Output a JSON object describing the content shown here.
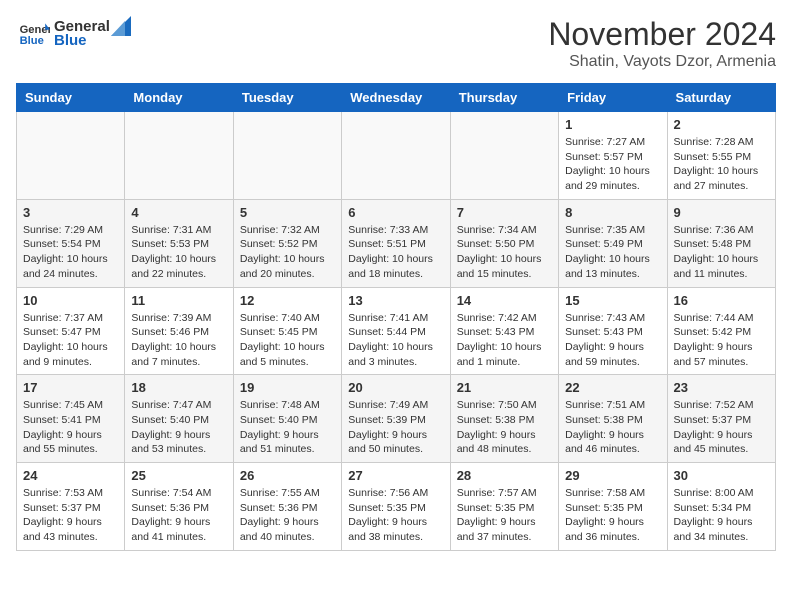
{
  "header": {
    "logo_general": "General",
    "logo_blue": "Blue",
    "month_title": "November 2024",
    "location": "Shatin, Vayots Dzor, Armenia"
  },
  "weekdays": [
    "Sunday",
    "Monday",
    "Tuesday",
    "Wednesday",
    "Thursday",
    "Friday",
    "Saturday"
  ],
  "weeks": [
    [
      {
        "day": "",
        "info": ""
      },
      {
        "day": "",
        "info": ""
      },
      {
        "day": "",
        "info": ""
      },
      {
        "day": "",
        "info": ""
      },
      {
        "day": "",
        "info": ""
      },
      {
        "day": "1",
        "info": "Sunrise: 7:27 AM\nSunset: 5:57 PM\nDaylight: 10 hours and 29 minutes."
      },
      {
        "day": "2",
        "info": "Sunrise: 7:28 AM\nSunset: 5:55 PM\nDaylight: 10 hours and 27 minutes."
      }
    ],
    [
      {
        "day": "3",
        "info": "Sunrise: 7:29 AM\nSunset: 5:54 PM\nDaylight: 10 hours and 24 minutes."
      },
      {
        "day": "4",
        "info": "Sunrise: 7:31 AM\nSunset: 5:53 PM\nDaylight: 10 hours and 22 minutes."
      },
      {
        "day": "5",
        "info": "Sunrise: 7:32 AM\nSunset: 5:52 PM\nDaylight: 10 hours and 20 minutes."
      },
      {
        "day": "6",
        "info": "Sunrise: 7:33 AM\nSunset: 5:51 PM\nDaylight: 10 hours and 18 minutes."
      },
      {
        "day": "7",
        "info": "Sunrise: 7:34 AM\nSunset: 5:50 PM\nDaylight: 10 hours and 15 minutes."
      },
      {
        "day": "8",
        "info": "Sunrise: 7:35 AM\nSunset: 5:49 PM\nDaylight: 10 hours and 13 minutes."
      },
      {
        "day": "9",
        "info": "Sunrise: 7:36 AM\nSunset: 5:48 PM\nDaylight: 10 hours and 11 minutes."
      }
    ],
    [
      {
        "day": "10",
        "info": "Sunrise: 7:37 AM\nSunset: 5:47 PM\nDaylight: 10 hours and 9 minutes."
      },
      {
        "day": "11",
        "info": "Sunrise: 7:39 AM\nSunset: 5:46 PM\nDaylight: 10 hours and 7 minutes."
      },
      {
        "day": "12",
        "info": "Sunrise: 7:40 AM\nSunset: 5:45 PM\nDaylight: 10 hours and 5 minutes."
      },
      {
        "day": "13",
        "info": "Sunrise: 7:41 AM\nSunset: 5:44 PM\nDaylight: 10 hours and 3 minutes."
      },
      {
        "day": "14",
        "info": "Sunrise: 7:42 AM\nSunset: 5:43 PM\nDaylight: 10 hours and 1 minute."
      },
      {
        "day": "15",
        "info": "Sunrise: 7:43 AM\nSunset: 5:43 PM\nDaylight: 9 hours and 59 minutes."
      },
      {
        "day": "16",
        "info": "Sunrise: 7:44 AM\nSunset: 5:42 PM\nDaylight: 9 hours and 57 minutes."
      }
    ],
    [
      {
        "day": "17",
        "info": "Sunrise: 7:45 AM\nSunset: 5:41 PM\nDaylight: 9 hours and 55 minutes."
      },
      {
        "day": "18",
        "info": "Sunrise: 7:47 AM\nSunset: 5:40 PM\nDaylight: 9 hours and 53 minutes."
      },
      {
        "day": "19",
        "info": "Sunrise: 7:48 AM\nSunset: 5:40 PM\nDaylight: 9 hours and 51 minutes."
      },
      {
        "day": "20",
        "info": "Sunrise: 7:49 AM\nSunset: 5:39 PM\nDaylight: 9 hours and 50 minutes."
      },
      {
        "day": "21",
        "info": "Sunrise: 7:50 AM\nSunset: 5:38 PM\nDaylight: 9 hours and 48 minutes."
      },
      {
        "day": "22",
        "info": "Sunrise: 7:51 AM\nSunset: 5:38 PM\nDaylight: 9 hours and 46 minutes."
      },
      {
        "day": "23",
        "info": "Sunrise: 7:52 AM\nSunset: 5:37 PM\nDaylight: 9 hours and 45 minutes."
      }
    ],
    [
      {
        "day": "24",
        "info": "Sunrise: 7:53 AM\nSunset: 5:37 PM\nDaylight: 9 hours and 43 minutes."
      },
      {
        "day": "25",
        "info": "Sunrise: 7:54 AM\nSunset: 5:36 PM\nDaylight: 9 hours and 41 minutes."
      },
      {
        "day": "26",
        "info": "Sunrise: 7:55 AM\nSunset: 5:36 PM\nDaylight: 9 hours and 40 minutes."
      },
      {
        "day": "27",
        "info": "Sunrise: 7:56 AM\nSunset: 5:35 PM\nDaylight: 9 hours and 38 minutes."
      },
      {
        "day": "28",
        "info": "Sunrise: 7:57 AM\nSunset: 5:35 PM\nDaylight: 9 hours and 37 minutes."
      },
      {
        "day": "29",
        "info": "Sunrise: 7:58 AM\nSunset: 5:35 PM\nDaylight: 9 hours and 36 minutes."
      },
      {
        "day": "30",
        "info": "Sunrise: 8:00 AM\nSunset: 5:34 PM\nDaylight: 9 hours and 34 minutes."
      }
    ]
  ]
}
